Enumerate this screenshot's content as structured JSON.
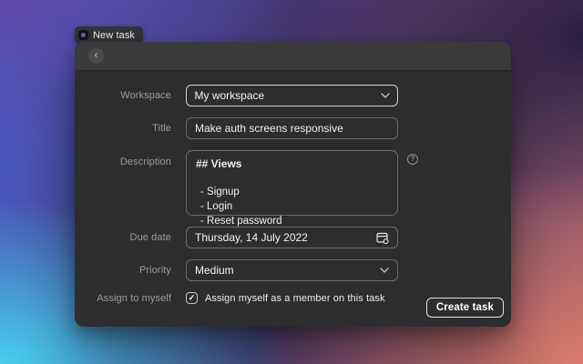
{
  "colors": {
    "modal_bg": "#2d2d2f",
    "modal_header_bg": "#3a3a3c",
    "field_border": "#6e6e71",
    "focused_field_border": "#d7d7d9",
    "button_border": "#e3e3e5",
    "label_text": "#9c9c9e",
    "value_text": "#f4f4f5",
    "badge_icon_dot": "#5666d6",
    "gradient_top_left": "#5d47a8",
    "gradient_left": "#4a5cc4",
    "gradient_bottom_left": "#48cfee",
    "gradient_bottom_right": "#da7b6b",
    "gradient_right": "#8c5468",
    "gradient_top_right": "#2a1f44"
  },
  "task_badge": {
    "label": "New task"
  },
  "modal": {
    "back_glyph": "‹",
    "form": {
      "workspace": {
        "label": "Workspace",
        "value": "My workspace"
      },
      "title": {
        "label": "Title",
        "value": "Make auth screens responsive"
      },
      "description": {
        "label": "Description",
        "heading": "## Views",
        "lines": [
          "- Signup",
          "- Login",
          "- Reset password"
        ],
        "help_glyph": "?"
      },
      "due_date": {
        "label": "Due date",
        "value": "Thursday, 14 July 2022"
      },
      "priority": {
        "label": "Priority",
        "value": "Medium"
      },
      "assign": {
        "label": "Assign to myself",
        "checked": true,
        "check_glyph": "✓",
        "checkbox_label": "Assign myself as a member on this task"
      }
    },
    "footer": {
      "create_button": "Create task"
    }
  }
}
